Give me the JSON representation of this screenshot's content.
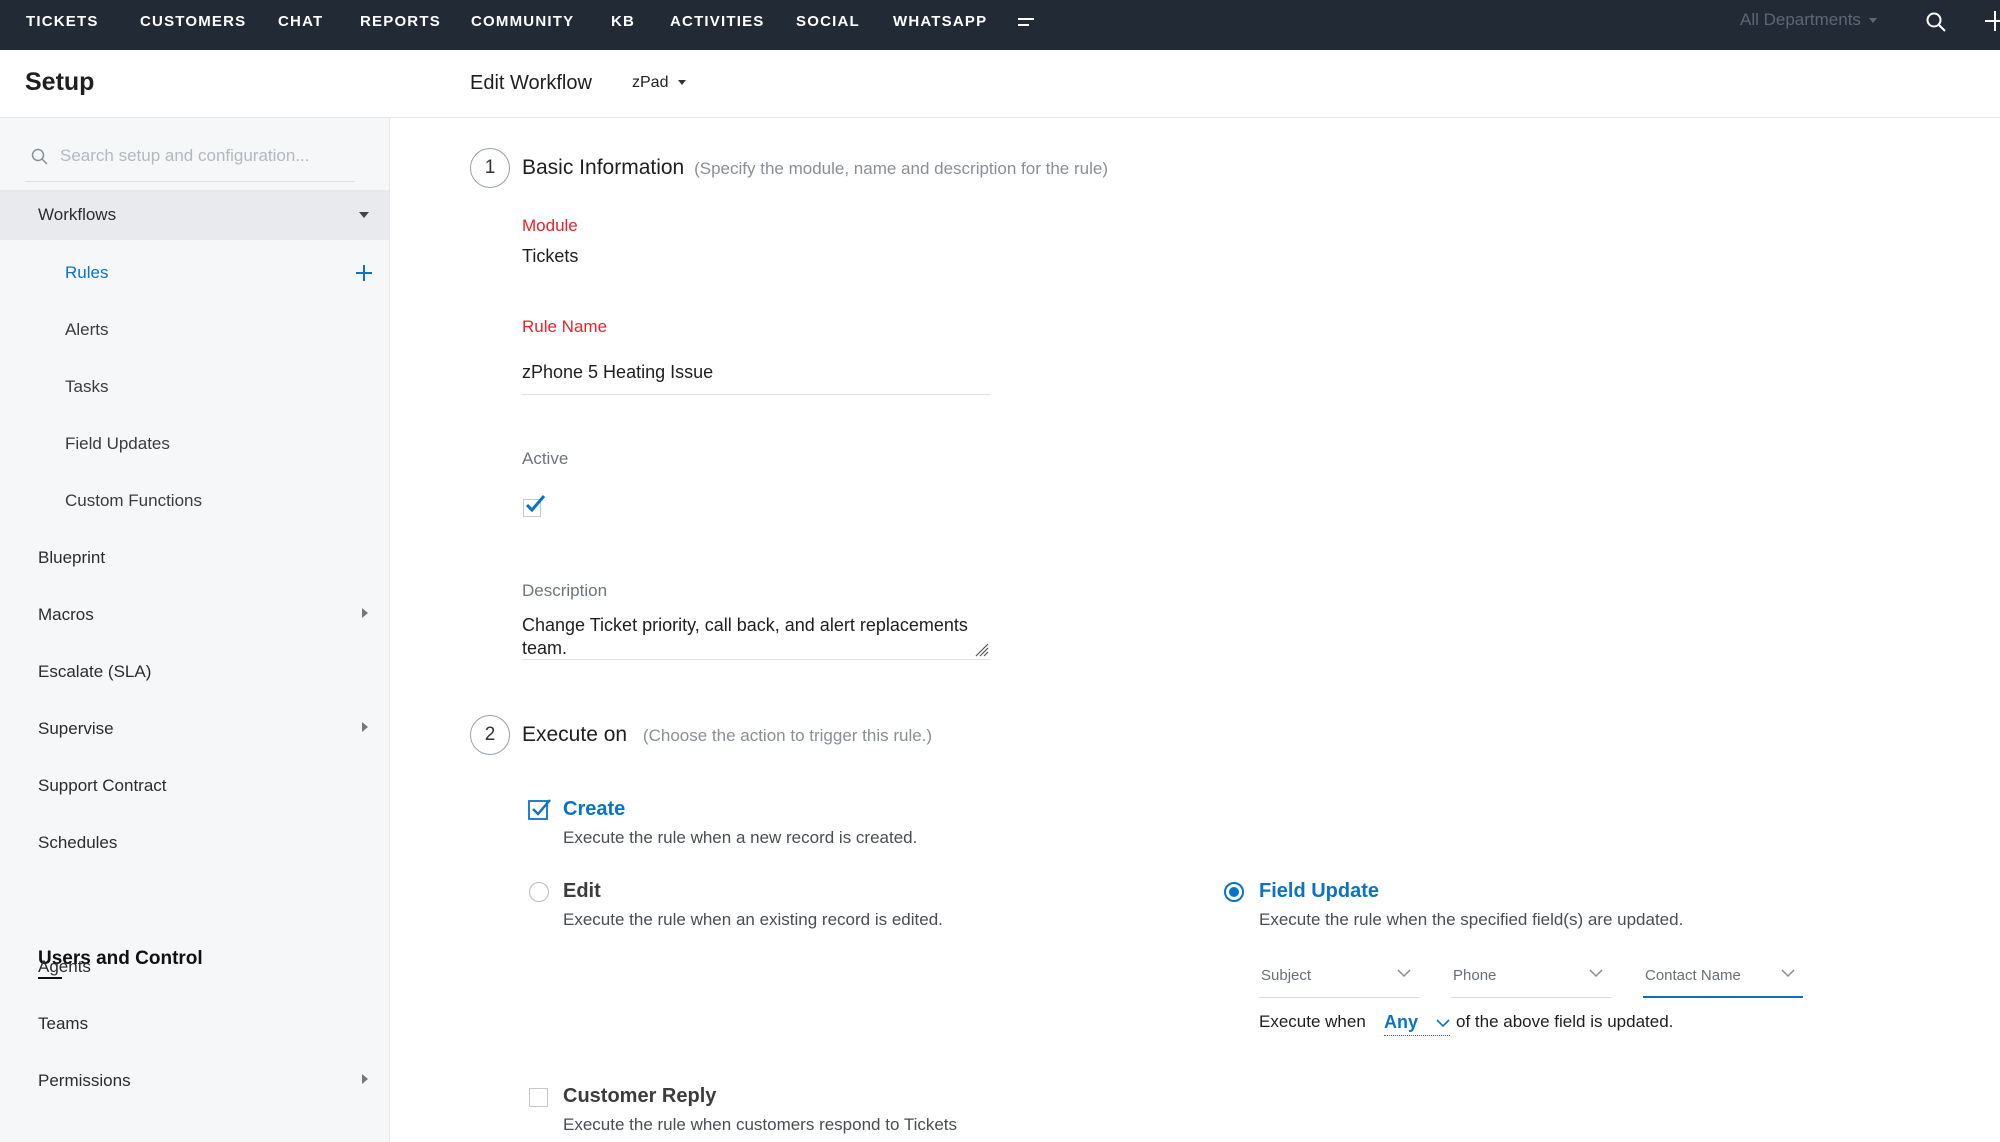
{
  "topnav": {
    "items": [
      "TICKETS",
      "CUSTOMERS",
      "CHAT",
      "REPORTS",
      "COMMUNITY",
      "KB",
      "ACTIVITIES",
      "SOCIAL",
      "WHATSAPP"
    ],
    "department": "All Departments"
  },
  "sidebar": {
    "title": "Setup",
    "search_placeholder": "Search setup and configuration...",
    "workflows_label": "Workflows",
    "sub_items": [
      "Rules",
      "Alerts",
      "Tasks",
      "Field Updates",
      "Custom Functions"
    ],
    "items": [
      "Blueprint",
      "Macros",
      "Escalate (SLA)",
      "Supervise",
      "Support Contract",
      "Schedules"
    ],
    "section2_title": "Users and Control",
    "section2_items": [
      "Agents",
      "Teams",
      "Permissions"
    ]
  },
  "header": {
    "title": "Edit Workflow",
    "department": "zPad"
  },
  "step1": {
    "number": "1",
    "title": "Basic Information",
    "hint": "(Specify the module, name and description for the rule)",
    "module_label": "Module",
    "module_value": "Tickets",
    "rule_name_label": "Rule Name",
    "rule_name_value": "zPhone 5 Heating Issue",
    "active_label": "Active",
    "active": true,
    "description_label": "Description",
    "description_value": "Change Ticket priority, call back, and alert replacements team."
  },
  "step2": {
    "number": "2",
    "title": "Execute on",
    "hint": "(Choose the action to trigger this rule.)",
    "create_title": "Create",
    "create_desc": "Execute the rule when a new record is created.",
    "edit_title": "Edit",
    "edit_desc": "Execute the rule when an existing record is edited.",
    "field_update_title": "Field Update",
    "field_update_desc": "Execute the rule when the specified field(s) are updated.",
    "fields": [
      "Subject",
      "Phone",
      "Contact Name"
    ],
    "execute_when_label": "Execute when",
    "execute_when_value": "Any",
    "execute_when_tail": "of the above field is updated.",
    "customer_reply_title": "Customer Reply",
    "customer_reply_desc": "Execute the rule when customers respond to Tickets"
  },
  "colors": {
    "topbar": "#222a36",
    "accent": "#0a73c8",
    "required": "#e8232a"
  }
}
